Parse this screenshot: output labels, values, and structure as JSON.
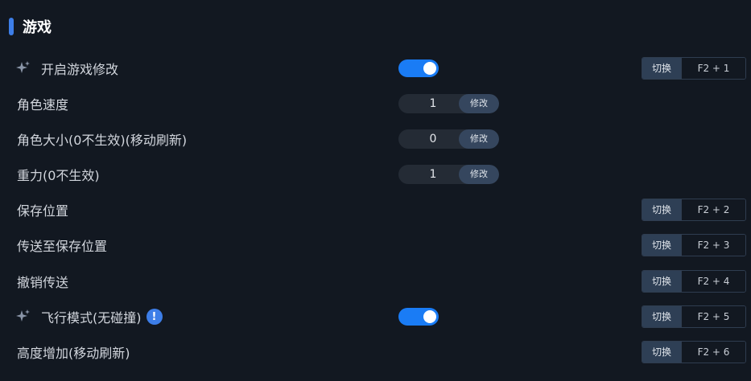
{
  "section": {
    "title": "游戏"
  },
  "colors": {
    "accent": "#3d7ee8",
    "toggle_on": "#1a7cf5",
    "background": "#121821"
  },
  "rows": [
    {
      "label": "开启游戏修改",
      "icon": "sparkle-icon",
      "toggle": true,
      "hotkey_action": "切换",
      "hotkey": "F2 + 1"
    },
    {
      "label": "角色速度",
      "stepper_value": "1",
      "stepper_button": "修改"
    },
    {
      "label": "角色大小(0不生效)(移动刷新)",
      "stepper_value": "0",
      "stepper_button": "修改"
    },
    {
      "label": "重力(0不生效)",
      "stepper_value": "1",
      "stepper_button": "修改"
    },
    {
      "label": "保存位置",
      "hotkey_action": "切换",
      "hotkey": "F2 + 2"
    },
    {
      "label": "传送至保存位置",
      "hotkey_action": "切换",
      "hotkey": "F2 + 3"
    },
    {
      "label": "撤销传送",
      "hotkey_action": "切换",
      "hotkey": "F2 + 4"
    },
    {
      "label": "飞行模式(无碰撞)",
      "icon": "sparkle-icon",
      "warning_icon": "!",
      "toggle": true,
      "hotkey_action": "切换",
      "hotkey": "F2 + 5"
    },
    {
      "label": "高度增加(移动刷新)",
      "hotkey_action": "切换",
      "hotkey": "F2 + 6"
    }
  ]
}
